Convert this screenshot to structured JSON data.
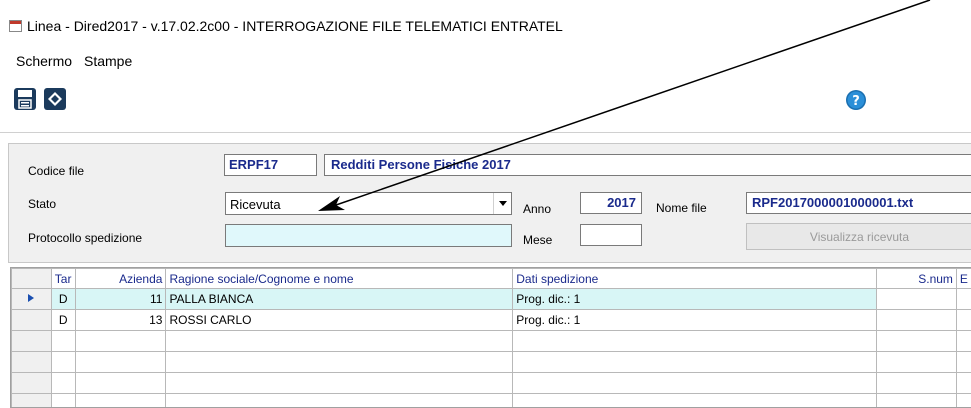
{
  "window": {
    "title": "Linea - Dired2017 - v.17.02.2c00 - INTERROGAZIONE FILE TELEMATICI ENTRATEL"
  },
  "menu": {
    "items": [
      {
        "label": "Schermo"
      },
      {
        "label": "Stampe"
      }
    ]
  },
  "toolbar": {
    "save_icon": "save-icon",
    "exit_icon": "exit-icon",
    "help_icon": "help-icon"
  },
  "form": {
    "codice_file_label": "Codice file",
    "codice_file_value": "ERPF17",
    "codice_file_desc": "Redditi Persone Fisiche 2017",
    "stato_label": "Stato",
    "stato_value": "Ricevuta",
    "protocollo_label": "Protocollo spedizione",
    "protocollo_value": "",
    "anno_label": "Anno",
    "anno_value": "2017",
    "mese_label": "Mese",
    "mese_value": "",
    "nome_file_label": "Nome file",
    "nome_file_value": "RPF2017000001000001.txt",
    "visualizza_button": "Visualizza ricevuta"
  },
  "grid": {
    "columns": [
      "Tar",
      "Azienda",
      "Ragione sociale/Cognome e nome",
      "Dati spedizione",
      "S.num",
      "E"
    ],
    "rows": [
      {
        "tar": "D",
        "azienda": "11",
        "ragione": "PALLA BIANCA",
        "dati": "Prog. dic.: 1",
        "snum": "",
        "e": ""
      },
      {
        "tar": "D",
        "azienda": "13",
        "ragione": "ROSSI CARLO",
        "dati": "Prog. dic.: 1",
        "snum": "",
        "e": ""
      }
    ]
  },
  "colors": {
    "accent_text": "#1a2a8c",
    "selected_row": "#d8f6f6",
    "protocollo_bg": "#e0f8fb"
  }
}
